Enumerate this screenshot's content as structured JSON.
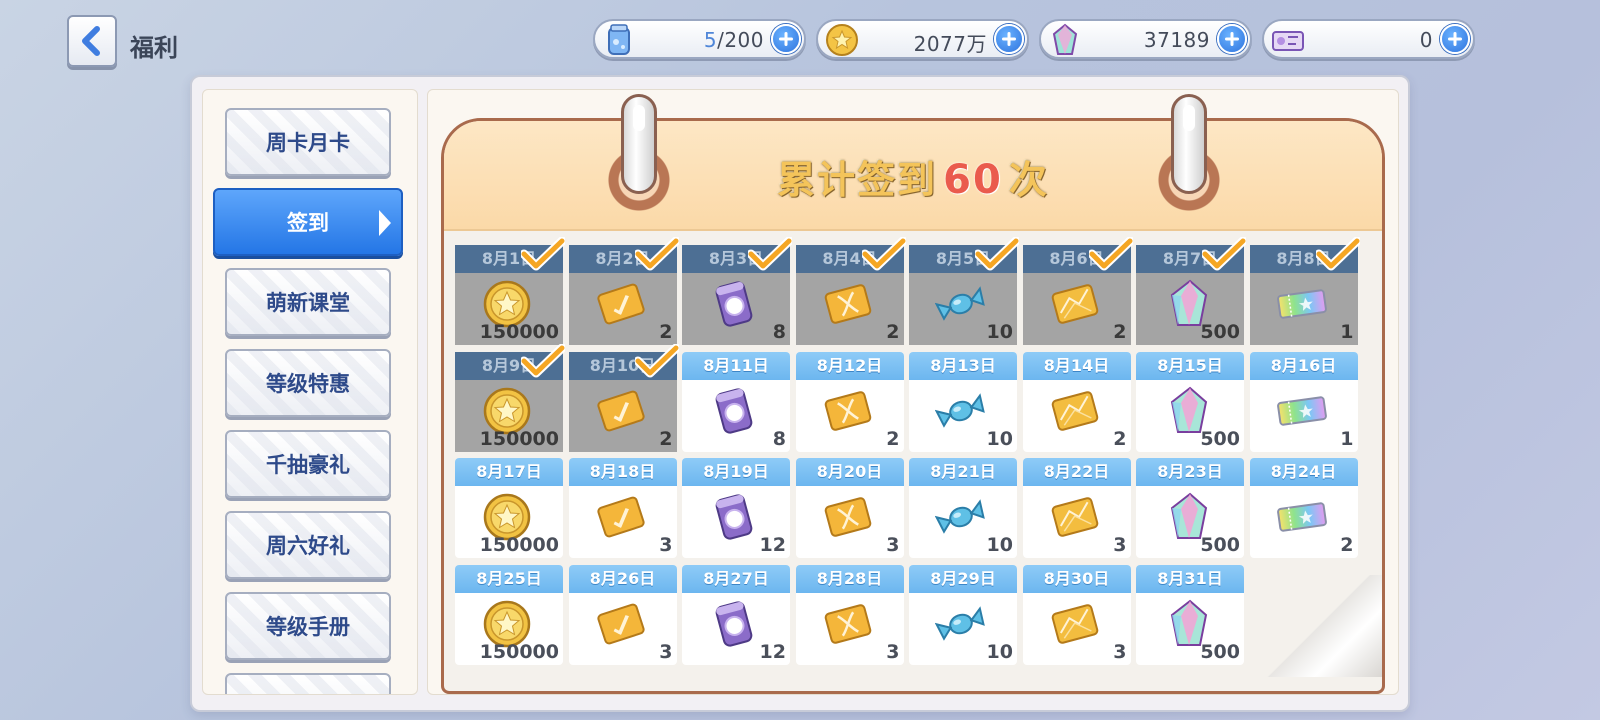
{
  "header": {
    "title": "福利",
    "resources": [
      {
        "name": "stamina",
        "icon": "stamina-jar-icon",
        "current": "5",
        "max": "/200"
      },
      {
        "name": "gold",
        "icon": "gold-coin-icon",
        "value": "2077万"
      },
      {
        "name": "crystal",
        "icon": "crystal-icon",
        "value": "37189"
      },
      {
        "name": "ticket",
        "icon": "ticket-icon",
        "value": "0"
      }
    ]
  },
  "sidebar": {
    "items": [
      {
        "label": "周卡月卡"
      },
      {
        "label": "签到",
        "active": true
      },
      {
        "label": "萌新课堂"
      },
      {
        "label": "等级特惠"
      },
      {
        "label": "千抽豪礼"
      },
      {
        "label": "周六好礼"
      },
      {
        "label": "等级手册"
      }
    ]
  },
  "calendar": {
    "title_prefix": "累计签到",
    "count": "60",
    "title_suffix": "次",
    "days": [
      {
        "date": "8月1日",
        "item": "coin",
        "qty": "150000",
        "claimed": true
      },
      {
        "date": "8月2日",
        "item": "sword-card",
        "qty": "2",
        "claimed": true
      },
      {
        "date": "8月3日",
        "item": "purple-can",
        "qty": "8",
        "claimed": true
      },
      {
        "date": "8月4日",
        "item": "dna-card",
        "qty": "2",
        "claimed": true
      },
      {
        "date": "8月5日",
        "item": "candy",
        "qty": "10",
        "claimed": true
      },
      {
        "date": "8月6日",
        "item": "gold-card",
        "qty": "2",
        "claimed": true
      },
      {
        "date": "8月7日",
        "item": "crystal",
        "qty": "500",
        "claimed": true
      },
      {
        "date": "8月8日",
        "item": "rainbow-ticket",
        "qty": "1",
        "claimed": true
      },
      {
        "date": "8月9日",
        "item": "coin",
        "qty": "150000",
        "claimed": true
      },
      {
        "date": "8月10日",
        "item": "sword-card",
        "qty": "2",
        "claimed": true
      },
      {
        "date": "8月11日",
        "item": "purple-can",
        "qty": "8",
        "claimed": false
      },
      {
        "date": "8月12日",
        "item": "dna-card",
        "qty": "2",
        "claimed": false
      },
      {
        "date": "8月13日",
        "item": "candy",
        "qty": "10",
        "claimed": false
      },
      {
        "date": "8月14日",
        "item": "gold-card",
        "qty": "2",
        "claimed": false
      },
      {
        "date": "8月15日",
        "item": "crystal",
        "qty": "500",
        "claimed": false
      },
      {
        "date": "8月16日",
        "item": "rainbow-ticket",
        "qty": "1",
        "claimed": false
      },
      {
        "date": "8月17日",
        "item": "coin",
        "qty": "150000",
        "claimed": false
      },
      {
        "date": "8月18日",
        "item": "sword-card",
        "qty": "3",
        "claimed": false
      },
      {
        "date": "8月19日",
        "item": "purple-can",
        "qty": "12",
        "claimed": false
      },
      {
        "date": "8月20日",
        "item": "dna-card",
        "qty": "3",
        "claimed": false
      },
      {
        "date": "8月21日",
        "item": "candy",
        "qty": "10",
        "claimed": false
      },
      {
        "date": "8月22日",
        "item": "gold-card",
        "qty": "3",
        "claimed": false
      },
      {
        "date": "8月23日",
        "item": "crystal",
        "qty": "500",
        "claimed": false
      },
      {
        "date": "8月24日",
        "item": "rainbow-ticket",
        "qty": "2",
        "claimed": false
      },
      {
        "date": "8月25日",
        "item": "coin",
        "qty": "150000",
        "claimed": false
      },
      {
        "date": "8月26日",
        "item": "sword-card",
        "qty": "3",
        "claimed": false
      },
      {
        "date": "8月27日",
        "item": "purple-can",
        "qty": "12",
        "claimed": false
      },
      {
        "date": "8月28日",
        "item": "dna-card",
        "qty": "3",
        "claimed": false
      },
      {
        "date": "8月29日",
        "item": "candy",
        "qty": "10",
        "claimed": false
      },
      {
        "date": "8月30日",
        "item": "gold-card",
        "qty": "3",
        "claimed": false
      },
      {
        "date": "8月31日",
        "item": "crystal",
        "qty": "500",
        "claimed": false
      }
    ]
  }
}
